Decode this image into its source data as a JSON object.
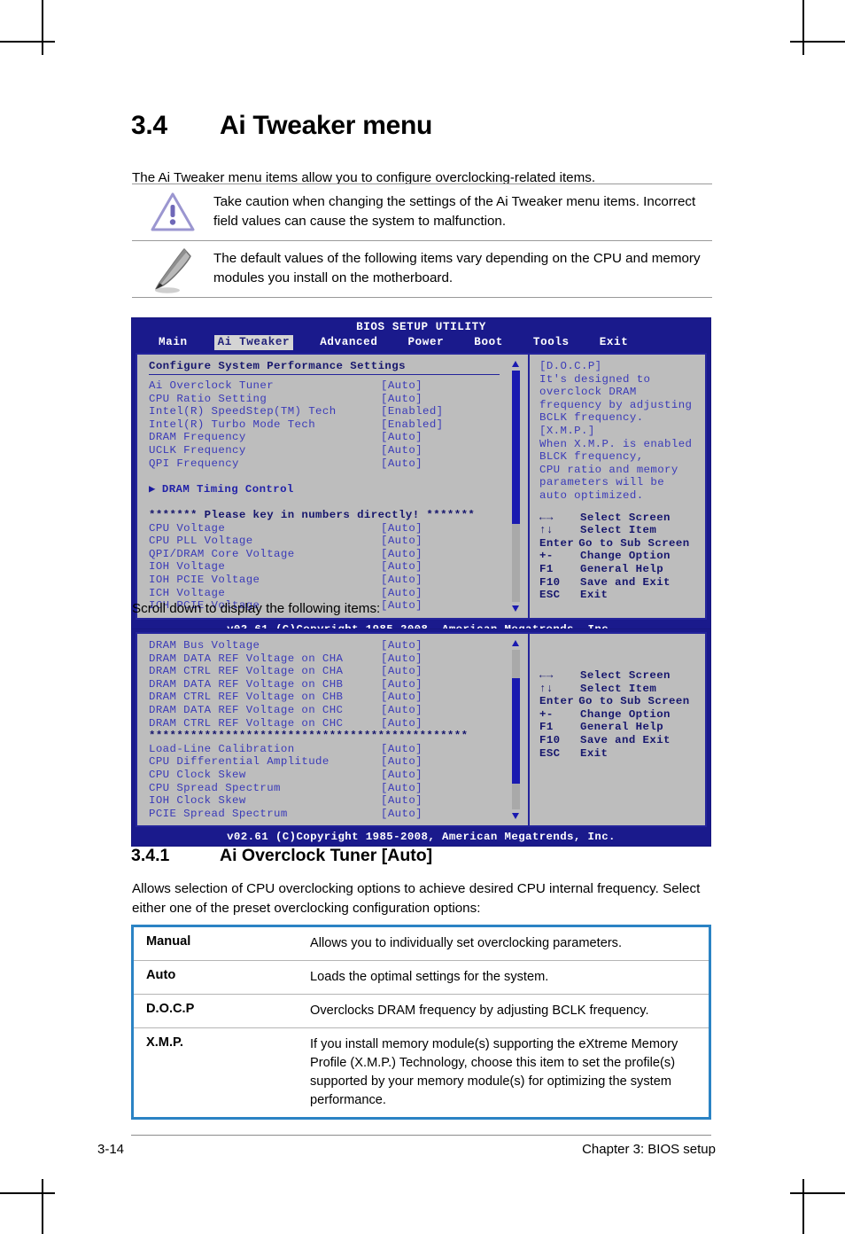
{
  "document": {
    "section": {
      "number": "3.4",
      "title": "Ai Tweaker menu"
    },
    "intro": "The Ai Tweaker menu items allow you to configure overclocking-related items.",
    "notes": [
      {
        "icon": "warning-triangle-icon",
        "text": "Take caution when changing the settings of the Ai Tweaker menu items. Incorrect field values can cause the system to malfunction."
      },
      {
        "icon": "pencil-note-icon",
        "text": "The default values of the following items vary depending on the CPU and memory modules you install on the motherboard."
      }
    ],
    "scroll_note": "Scroll down to display the following items:",
    "subsection": {
      "number": "3.4.1",
      "title": "Ai Overclock Tuner [Auto]"
    },
    "subsection_body": "Allows selection of CPU overclocking options to achieve desired CPU internal frequency. Select either one of the preset overclocking configuration options:",
    "options_table": [
      {
        "term": "Manual",
        "desc": "Allows you to individually set overclocking parameters."
      },
      {
        "term": "Auto",
        "desc": "Loads the optimal settings for the system."
      },
      {
        "term": "D.O.C.P",
        "desc": "Overclocks DRAM frequency by adjusting BCLK frequency."
      },
      {
        "term": "X.M.P.",
        "desc": "If you install memory module(s) supporting the eXtreme Memory Profile (X.M.P.) Technology, choose this item to set the profile(s) supported by your memory module(s) for optimizing the system performance."
      }
    ],
    "footer": {
      "page": "3-14",
      "chapter": "Chapter 3: BIOS setup"
    }
  },
  "bios": {
    "utility_title": "BIOS SETUP UTILITY",
    "tabs": [
      {
        "label": "Main",
        "active": false
      },
      {
        "label": "Ai Tweaker",
        "active": true
      },
      {
        "label": "Advanced",
        "active": false
      },
      {
        "label": "Power",
        "active": false
      },
      {
        "label": "Boot",
        "active": false
      },
      {
        "label": "Tools",
        "active": false
      },
      {
        "label": "Exit",
        "active": false
      }
    ],
    "copyright": "v02.61 (C)Copyright 1985-2008, American Megatrends, Inc.",
    "screen1": {
      "heading": "Configure System Performance Settings",
      "items": [
        {
          "label": "Ai Overclock Tuner",
          "value": "[Auto]"
        },
        {
          "label": "CPU Ratio Setting",
          "value": "[Auto]"
        },
        {
          "label": "Intel(R) SpeedStep(TM) Tech",
          "value": "[Enabled]"
        },
        {
          "label": "Intel(R) Turbo Mode Tech",
          "value": "[Enabled]"
        },
        {
          "label": "DRAM Frequency",
          "value": "[Auto]"
        },
        {
          "label": "UCLK Frequency",
          "value": "[Auto]"
        },
        {
          "label": "QPI Frequency",
          "value": "[Auto]"
        }
      ],
      "submenu": "DRAM Timing Control",
      "stars_line": "******* Please key in numbers directly! *******",
      "items2": [
        {
          "label": "CPU Voltage",
          "value": "[Auto]"
        },
        {
          "label": "CPU PLL Voltage",
          "value": "[Auto]"
        },
        {
          "label": "QPI/DRAM Core Voltage",
          "value": "[Auto]"
        },
        {
          "label": "IOH Voltage",
          "value": "[Auto]"
        },
        {
          "label": "IOH PCIE Voltage",
          "value": "[Auto]"
        },
        {
          "label": "ICH Voltage",
          "value": "[Auto]"
        },
        {
          "label": "ICH PCIE Voltage",
          "value": "[Auto]"
        }
      ],
      "help": [
        "[D.O.C.P]",
        "It's designed to",
        "overclock DRAM",
        "frequency by adjusting",
        "BCLK frequency.",
        "[X.M.P.]",
        "When X.M.P. is enabled",
        "BLCK frequency,",
        "CPU ratio and memory",
        "parameters will be",
        "auto optimized."
      ]
    },
    "screen2": {
      "items": [
        {
          "label": "DRAM Bus Voltage",
          "value": "[Auto]"
        },
        {
          "label": "DRAM DATA REF Voltage on CHA",
          "value": "[Auto]"
        },
        {
          "label": "DRAM CTRL REF Voltage on CHA",
          "value": "[Auto]"
        },
        {
          "label": "DRAM DATA REF Voltage on CHB",
          "value": "[Auto]"
        },
        {
          "label": "DRAM CTRL REF Voltage on CHB",
          "value": "[Auto]"
        },
        {
          "label": "DRAM DATA REF Voltage on CHC",
          "value": "[Auto]"
        },
        {
          "label": "DRAM CTRL REF Voltage on CHC",
          "value": "[Auto]"
        }
      ],
      "stars_line": "**********************************************",
      "items2": [
        {
          "label": "Load-Line Calibration",
          "value": "[Auto]"
        },
        {
          "label": "CPU Differential Amplitude",
          "value": "[Auto]"
        },
        {
          "label": "CPU Clock Skew",
          "value": "[Auto]"
        },
        {
          "label": "CPU Spread Spectrum",
          "value": "[Auto]"
        },
        {
          "label": "IOH Clock Skew",
          "value": "[Auto]"
        },
        {
          "label": "PCIE Spread Spectrum",
          "value": "[Auto]"
        }
      ]
    },
    "keys": [
      {
        "key": "←→",
        "desc": "Select Screen"
      },
      {
        "key": "↑↓",
        "desc": "Select Item"
      },
      {
        "key": "Enter",
        "desc": "Go to Sub Screen",
        "wide": true
      },
      {
        "key": "+-",
        "desc": "Change Option"
      },
      {
        "key": "F1",
        "desc": "General Help"
      },
      {
        "key": "F10",
        "desc": "Save and Exit"
      },
      {
        "key": "ESC",
        "desc": "Exit"
      }
    ]
  },
  "colors": {
    "bios_chrome": "#1a1a8c",
    "bios_panel": "#bdbdbd",
    "bios_item_text": "#3a3ab8",
    "bios_heading_text": "#16166d",
    "table_border": "#2b83c4"
  }
}
